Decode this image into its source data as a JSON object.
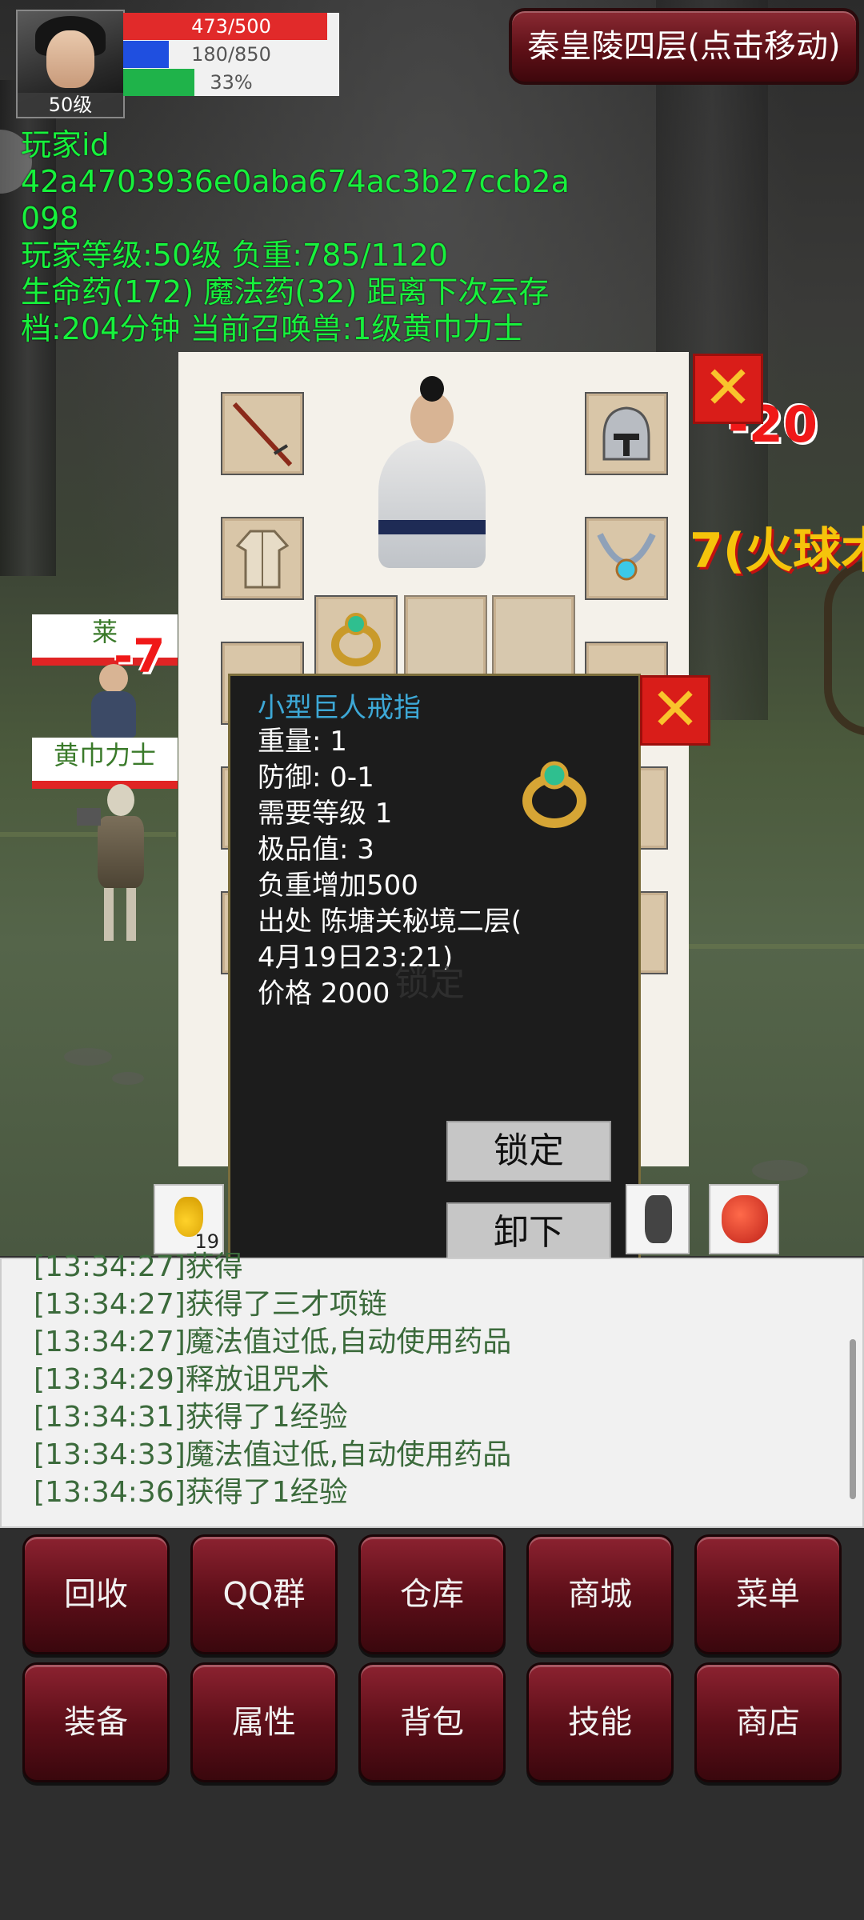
{
  "top": {
    "level": "50级",
    "hp": {
      "text": "473/500",
      "fraction": 0.946,
      "color": "#e12a2a"
    },
    "mp": {
      "text": "180/850",
      "fraction": 0.212,
      "color": "#1f4fe0"
    },
    "xp": {
      "text": "33%",
      "fraction": 0.33,
      "color": "#1fb34a"
    },
    "map_button": "秦皇陵四层(点击移动)"
  },
  "info": {
    "line1": "玩家id",
    "line2": "42a4703936e0aba674ac3b27ccb2a",
    "line3": "098",
    "line4": "玩家等级:50级 负重:785/1120",
    "line5": "生命药(172) 魔法药(32) 距离下次云存",
    "line6": "档:204分钟 当前召唤兽:1级黄巾力士"
  },
  "floating": {
    "dmg1": "-20",
    "dmg2": "-7",
    "skill": "7(火球术"
  },
  "units": {
    "ally_name": "莱",
    "summon_name": "黄巾力士"
  },
  "tooltip": {
    "title": "小型巨人戒指",
    "weight": "重量: 1",
    "defense": "防御: 0-1",
    "req_level": "需要等级 1",
    "quality": "极品值: 3",
    "load": "负重增加500",
    "source": "出处 陈塘关秘境二层(",
    "date": "4月19日23:21)",
    "price": "价格 2000",
    "lock_button": "锁定",
    "unequip_button": "卸下",
    "ghost_lock": "锁定"
  },
  "quickbar": {
    "potion_count": "19"
  },
  "log": [
    "[13:34:27]获得",
    "[13:34:27]获得了三才项链",
    "[13:34:27]魔法值过低,自动使用药品",
    "[13:34:29]释放诅咒术",
    "[13:34:31]获得了1经验",
    "[13:34:33]魔法值过低,自动使用药品",
    "[13:34:36]获得了1经验"
  ],
  "menu": {
    "row1": [
      "回收",
      "QQ群",
      "仓库",
      "商城",
      "菜单"
    ],
    "row2": [
      "装备",
      "属性",
      "背包",
      "技能",
      "商店"
    ]
  }
}
